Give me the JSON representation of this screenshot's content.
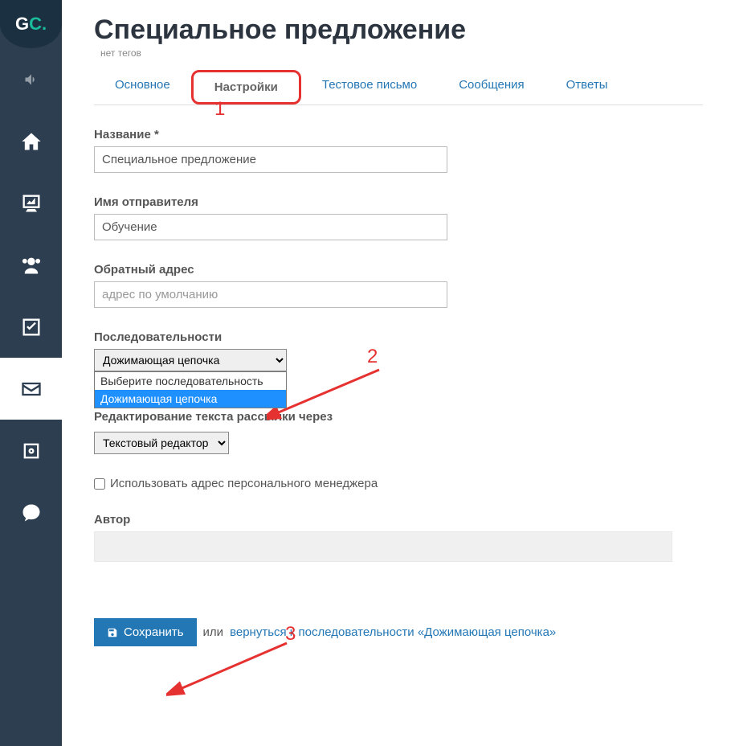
{
  "logo": {
    "g": "G",
    "c": "C."
  },
  "page": {
    "title": "Специальное предложение",
    "tags_note": "нет тегов"
  },
  "tabs": {
    "t0": "Основное",
    "t1": "Настройки",
    "t2": "Тестовое письмо",
    "t3": "Сообщения",
    "t4": "Ответы"
  },
  "form": {
    "name_label": "Название *",
    "name_value": "Специальное предложение",
    "sender_label": "Имя отправителя",
    "sender_value": "Обучение",
    "reply_label": "Обратный адрес",
    "reply_placeholder": "адрес по умолчанию",
    "seq_label": "Последовательности",
    "seq_selected": "Дожимающая цепочка",
    "seq_options": {
      "o0": "Выберите последовательность",
      "o1": "Дожимающая цепочка"
    },
    "editor_label": "Редактирование текста рассылки через",
    "editor_selected": "Текстовый редактор",
    "use_manager_label": "Использовать адрес персонального менеджера",
    "author_label": "Автор"
  },
  "actions": {
    "save": "Сохранить",
    "or": "или",
    "back_link": "вернуться к последовательности «Дожимающая цепочка»"
  },
  "annotations": {
    "n1": "1",
    "n2": "2",
    "n3": "3"
  }
}
